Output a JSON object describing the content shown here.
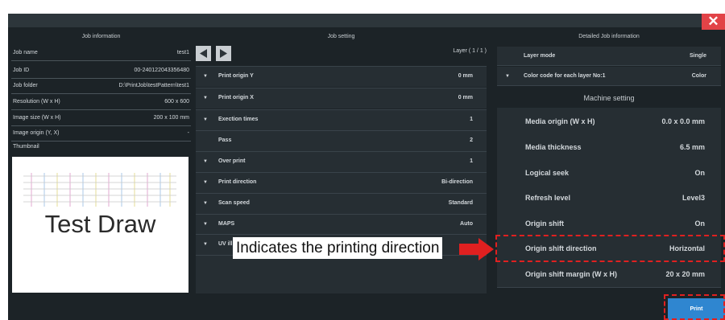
{
  "colors": {
    "window_bg": "#1c2327",
    "row_bg": "#262e33",
    "close": "#e24347",
    "print": "#2f86d0",
    "highlight": "#e02020"
  },
  "icons": {
    "close": "close-icon",
    "prev": "prev-arrow-icon",
    "next": "next-arrow-icon",
    "expand": "expand-triangle-icon"
  },
  "close_label": "✕",
  "job_info": {
    "header": "Job information",
    "rows": [
      {
        "label": "Job name",
        "value": "test1"
      },
      {
        "label": "Job ID",
        "value": "00-240122043356480"
      },
      {
        "label": "Job folder",
        "value": "D:\\PrintJob\\testPattern\\test1"
      },
      {
        "label": "Resolution (W x H)",
        "value": "600 x 600"
      },
      {
        "label": "Image size (W x H)",
        "value": "200 x 100 mm"
      },
      {
        "label": "Image origin (Y, X)",
        "value": "-"
      }
    ],
    "thumbnail_label": "Thumbnail",
    "thumbnail_text": "Test Draw"
  },
  "job_setting": {
    "header": "Job setting",
    "layer": "Layer ( 1 / 1 )",
    "rows": [
      {
        "label": "Print origin Y",
        "value": "0 mm",
        "arrow": "▼"
      },
      {
        "label": "Print origin X",
        "value": "0 mm",
        "arrow": "▼"
      },
      {
        "label": "Exection times",
        "value": "1",
        "arrow": "▼"
      },
      {
        "label": "Pass",
        "value": "2",
        "arrow": ""
      },
      {
        "label": "Over print",
        "value": "1",
        "arrow": "▼"
      },
      {
        "label": "Print direction",
        "value": "Bi-direction",
        "arrow": "▼"
      },
      {
        "label": "Scan speed",
        "value": "Standard",
        "arrow": "▼"
      },
      {
        "label": "MAPS",
        "value": "Auto",
        "arrow": "▼"
      },
      {
        "label": "UV ill",
        "value": "",
        "arrow": "▼"
      }
    ]
  },
  "detailed": {
    "header": "Detailed Job information",
    "rows": [
      {
        "label": "Layer mode",
        "value": "Single",
        "arrow": ""
      },
      {
        "label": "Color code for each layer No:1",
        "value": "Color",
        "arrow": "▼"
      }
    ]
  },
  "machine": {
    "header": "Machine setting",
    "rows": [
      {
        "label": "Media origin (W x H)",
        "value": "0.0 x 0.0 mm"
      },
      {
        "label": "Media thickness",
        "value": "6.5 mm"
      },
      {
        "label": "Logical seek",
        "value": "On"
      },
      {
        "label": "Refresh level",
        "value": "Level3"
      },
      {
        "label": "Origin shift",
        "value": "On"
      },
      {
        "label": "Origin shift direction",
        "value": "Horizontal"
      },
      {
        "label": "Origin shift margin (W x H)",
        "value": "20 x 20 mm"
      }
    ]
  },
  "print_label": "Print",
  "callout": "Indicates the printing direction"
}
